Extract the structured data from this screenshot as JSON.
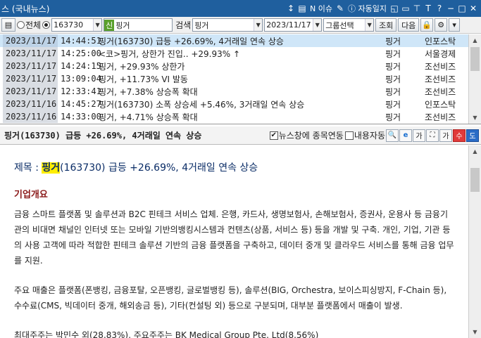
{
  "window": {
    "title": "스 (국내뉴스)"
  },
  "titlebar_icons": [
    {
      "name": "pin-icon",
      "glyph": "↕"
    },
    {
      "name": "page-icon",
      "glyph": "▤"
    },
    {
      "name": "issue-label",
      "glyph": "N 이슈"
    },
    {
      "name": "calendar-icon",
      "glyph": "✎"
    },
    {
      "name": "auto-log-label",
      "glyph": "ⓘ 자동일지"
    },
    {
      "name": "layout-icon",
      "glyph": "◱"
    },
    {
      "name": "window-icon",
      "glyph": "▭"
    },
    {
      "name": "pin2-icon",
      "glyph": "⊤"
    },
    {
      "name": "font-icon",
      "glyph": "T"
    },
    {
      "name": "help-icon",
      "glyph": "?"
    },
    {
      "name": "minimize-icon",
      "glyph": "−"
    },
    {
      "name": "maximize-icon",
      "glyph": "□"
    },
    {
      "name": "close-icon",
      "glyph": "✕"
    }
  ],
  "toolbar": {
    "list_icon": "▤",
    "radio_all": "전체",
    "code_value": "163730",
    "sin_badge": "신",
    "stock_name": "핑거",
    "search_label": "검색",
    "search_value": "핑거",
    "date_value": "2023/11/17",
    "group_select": "그룹선택",
    "query_button": "조회",
    "next_button": "다음"
  },
  "news_rows": [
    {
      "date": "2023/11/17",
      "time": "14:44:51",
      "headline": "핑거(163730) 급등 +26.69%, 4거래일 연속 상승",
      "stock": "핑거",
      "source": "인포스탁"
    },
    {
      "date": "2023/11/17",
      "time": "14:25:00",
      "headline": "<코>핑거, 상한가 진입.. +29.93% ↑",
      "stock": "핑거",
      "source": "서울경제"
    },
    {
      "date": "2023/11/17",
      "time": "14:24:15",
      "headline": "핑거, +29.93% 상한가",
      "stock": "핑거",
      "source": "조선비즈"
    },
    {
      "date": "2023/11/17",
      "time": "13:09:04",
      "headline": "핑거, +11.73% VI 발동",
      "stock": "핑거",
      "source": "조선비즈"
    },
    {
      "date": "2023/11/17",
      "time": "12:33:41",
      "headline": "핑거, +7.38% 상승폭 확대",
      "stock": "핑거",
      "source": "조선비즈"
    },
    {
      "date": "2023/11/16",
      "time": "14:45:27",
      "headline": "핑거(163730) 소폭 상승세 +5.46%, 3거래일 연속 상승",
      "stock": "핑거",
      "source": "인포스탁"
    },
    {
      "date": "2023/11/16",
      "time": "14:33:00",
      "headline": "핑거, +4.71% 상승폭 확대",
      "stock": "핑거",
      "source": "조선비즈"
    }
  ],
  "detail_bar": {
    "headline": "핑거(163730) 급등 +26.69%, 4거래일 연속 상승",
    "link_checkbox": "뉴스창에 종목연동",
    "auto_checkbox": "내용자동",
    "font_small": "가",
    "font_big": "가",
    "edit_button": "수",
    "save_button": "도"
  },
  "article": {
    "subject_prefix": "제목 : ",
    "subject_highlight": "핑거",
    "subject_rest": "(163730) 급등 +26.69%, 4거래일 연속 상승",
    "section_title": "기업개요",
    "para1": "금융 스마트 플랫폼 및 솔루션과 B2C 핀테크 서비스 업체. 은행, 카드사, 생명보험사, 손해보험사, 증권사, 운용사 등 금융기관의 비대면 채널인 인터넷 또는 모바일 기반의뱅킹시스템과 컨텐츠(상품, 서비스 등) 등을 개발 및 구축. 개인, 기업, 기관 등의 사용 고객에 따라 적합한 핀테크 솔루션 기반의 금융 플랫폼을 구축하고, 데이터 중개 및 클라우드 서비스를 통해 금융 업무를 지원.",
    "para2": "주요 매출은 플랫폼(폰뱅킹, 금융포탈, 오픈뱅킹, 글로벌뱅킹 등), 솔루션(BIG, Orchestra, 보이스피싱방지, F-Chain 등), 수수료(CMS, 빅데이터 중개, 해외송금 등), 기타(컨설팅 외) 등으로 구분되며, 대부분 플랫폼에서 매출이 발생.",
    "para3": "최대주주는 박민수 외(28.83%), 주요주주는 BK Medical Group Pte. Ltd(8.56%)"
  }
}
